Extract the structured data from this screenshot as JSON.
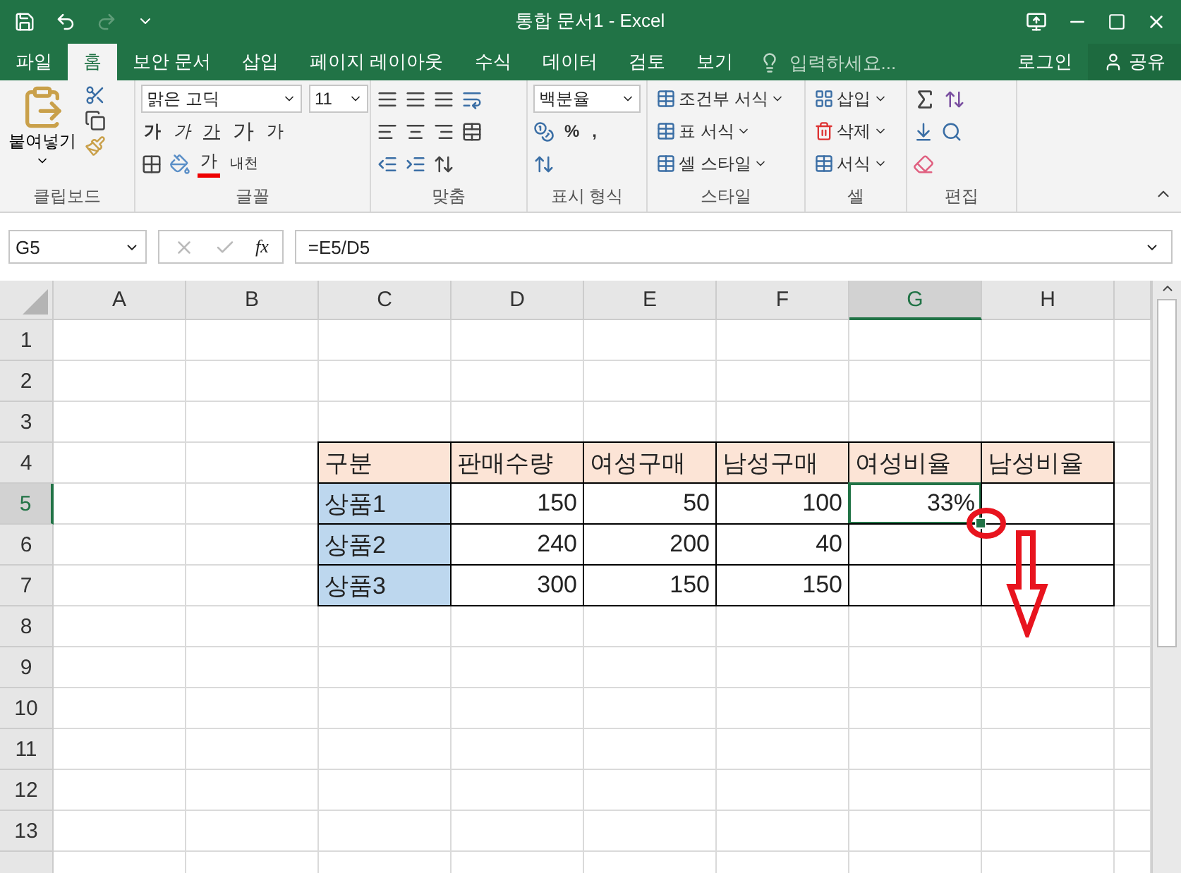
{
  "window": {
    "title": "통합 문서1 - Excel"
  },
  "ribbon_tabs": [
    {
      "label": "파일",
      "selected": false
    },
    {
      "label": "홈",
      "selected": true
    },
    {
      "label": "보안 문서",
      "selected": false
    },
    {
      "label": "삽입",
      "selected": false
    },
    {
      "label": "페이지 레이아웃",
      "selected": false
    },
    {
      "label": "수식",
      "selected": false
    },
    {
      "label": "데이터",
      "selected": false
    },
    {
      "label": "검토",
      "selected": false
    },
    {
      "label": "보기",
      "selected": false
    }
  ],
  "tell_me": {
    "placeholder": "입력하세요..."
  },
  "account": {
    "sign_in": "로그인",
    "share": "공유"
  },
  "ribbon": {
    "clipboard": {
      "paste": "붙여넣기",
      "label": "클립보드"
    },
    "font": {
      "font_name": "맑은 고딕",
      "font_size": "11",
      "bold": "가",
      "italic": "가",
      "underline": "가",
      "grow": "가",
      "shrink": "가",
      "font_color": "가",
      "phonetic": "내천",
      "label": "글꼴"
    },
    "alignment": {
      "label": "맞춤"
    },
    "number": {
      "format": "백분율",
      "percent": "%",
      "comma": ",",
      "label": "표시 형식"
    },
    "styles": {
      "items": [
        "조건부 서식",
        "표 서식",
        "셀 스타일"
      ],
      "label": "스타일"
    },
    "cells": {
      "items": [
        "삽입",
        "삭제",
        "서식"
      ],
      "label": "셀"
    },
    "editing": {
      "label": "편집"
    }
  },
  "formula_bar": {
    "name_box": "G5",
    "fx": "fx",
    "formula": "=E5/D5"
  },
  "sheet": {
    "columns": [
      {
        "label": "A",
        "selected": false
      },
      {
        "label": "B",
        "selected": false
      },
      {
        "label": "C",
        "selected": false
      },
      {
        "label": "D",
        "selected": false
      },
      {
        "label": "E",
        "selected": false
      },
      {
        "label": "F",
        "selected": false
      },
      {
        "label": "G",
        "selected": true
      },
      {
        "label": "H",
        "selected": false
      }
    ],
    "rows": [
      {
        "label": "1",
        "selected": false
      },
      {
        "label": "2",
        "selected": false
      },
      {
        "label": "3",
        "selected": false
      },
      {
        "label": "4",
        "selected": false
      },
      {
        "label": "5",
        "selected": true
      },
      {
        "label": "6",
        "selected": false
      },
      {
        "label": "7",
        "selected": false
      },
      {
        "label": "8",
        "selected": false
      },
      {
        "label": "9",
        "selected": false
      },
      {
        "label": "10",
        "selected": false
      },
      {
        "label": "11",
        "selected": false
      },
      {
        "label": "12",
        "selected": false
      },
      {
        "label": "13",
        "selected": false
      }
    ],
    "table": {
      "columns": [
        "구분",
        "판매수량",
        "여성구매",
        "남성구매",
        "여성비율",
        "남성비율"
      ],
      "rows": [
        {
          "label": "상품1",
          "values": [
            {
              "text": "150",
              "selected": false
            },
            {
              "text": "50",
              "selected": false
            },
            {
              "text": "100",
              "selected": false
            },
            {
              "text": "33%",
              "selected": true
            }
          ]
        },
        {
          "label": "상품2",
          "values": [
            {
              "text": "240",
              "selected": false
            },
            {
              "text": "200",
              "selected": false
            },
            {
              "text": "40",
              "selected": false
            }
          ]
        },
        {
          "label": "상품3",
          "values": [
            {
              "text": "300",
              "selected": false
            },
            {
              "text": "150",
              "selected": false
            },
            {
              "text": "150",
              "selected": false
            }
          ]
        }
      ]
    }
  }
}
